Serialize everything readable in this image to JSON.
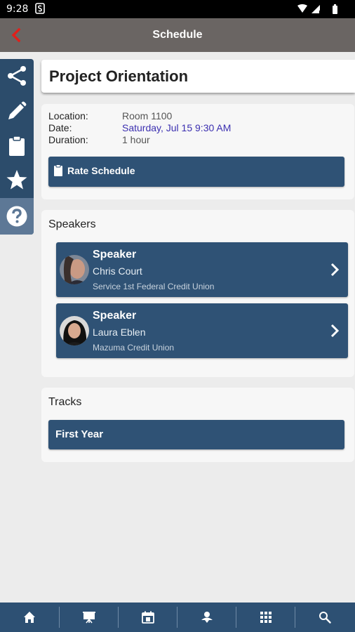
{
  "status_bar": {
    "time": "9:28"
  },
  "app_bar": {
    "title": "Schedule"
  },
  "session": {
    "title": "Project Orientation",
    "location_label": "Location:",
    "location_value": "Room 1100",
    "date_label": "Date:",
    "date_value": "Saturday, Jul 15 9:30 AM",
    "duration_label": "Duration:",
    "duration_value": "1 hour",
    "rate_button": "Rate Schedule"
  },
  "speakers": {
    "heading": "Speakers",
    "items": [
      {
        "role": "Speaker",
        "name": "Chris Court",
        "org": "Service 1st Federal Credit Union"
      },
      {
        "role": "Speaker",
        "name": "Laura Eblen",
        "org": "Mazuma Credit Union"
      }
    ]
  },
  "tracks": {
    "heading": "Tracks",
    "items": [
      {
        "label": "First Year"
      }
    ]
  },
  "side_rail": {
    "icons": [
      "share-icon",
      "pencil-icon",
      "clipboard-icon",
      "star-icon",
      "help-icon"
    ]
  },
  "bottom_nav": {
    "icons": [
      "home-icon",
      "presentation-icon",
      "calendar-icon",
      "person-pin-icon",
      "grid-icon",
      "search-icon"
    ]
  },
  "colors": {
    "app_bar": "#6a6563",
    "accent_blue": "#2f5275",
    "back_arrow": "#e0201b",
    "date_link": "#3b2fb0"
  }
}
